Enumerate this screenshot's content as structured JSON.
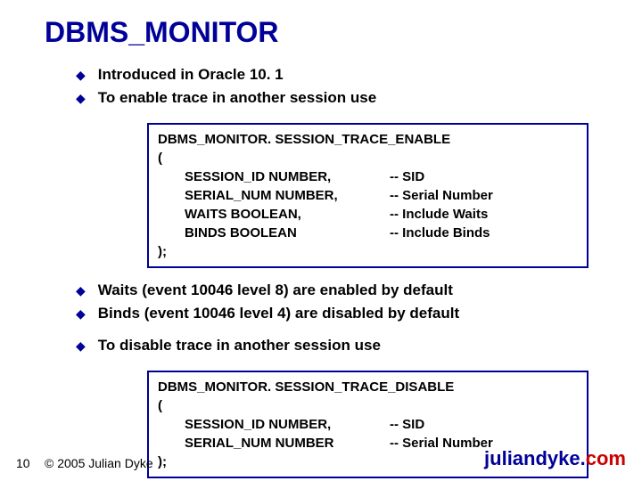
{
  "title": "DBMS_MONITOR",
  "bullets": {
    "b1": "Introduced in Oracle 10. 1",
    "b2": "To enable trace in another session use",
    "b3": "Waits (event 10046 level 8) are enabled by default",
    "b4": "Binds (event 10046 level 4) are disabled by default",
    "b5": "To disable trace in another session use"
  },
  "code1": {
    "line1": "DBMS_MONITOR. SESSION_TRACE_ENABLE",
    "open": "(",
    "r1c1": "SESSION_ID NUMBER,",
    "r1c2": "-- SID",
    "r2c1": "SERIAL_NUM NUMBER,",
    "r2c2": "-- Serial Number",
    "r3c1": "WAITS BOOLEAN,",
    "r3c2": "-- Include Waits",
    "r4c1": "BINDS BOOLEAN",
    "r4c2": "-- Include Binds",
    "close": ");"
  },
  "code2": {
    "line1": "DBMS_MONITOR. SESSION_TRACE_DISABLE",
    "open": "(",
    "r1c1": "SESSION_ID NUMBER,",
    "r1c2": "-- SID",
    "r2c1": "SERIAL_NUM NUMBER",
    "r2c2": "-- Serial Number",
    "close": ");"
  },
  "footer": {
    "page": "10",
    "copyright": "© 2005 Julian Dyke",
    "site_main": "juliandyke.",
    "site_tld": "com"
  }
}
